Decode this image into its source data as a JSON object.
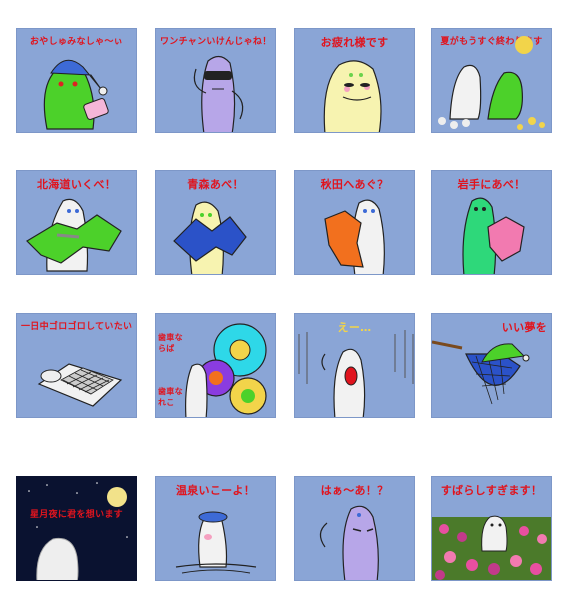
{
  "stickers": [
    {
      "caption": "おやしゅみなしゃ〜ぃ",
      "icon": "sleepy-green-character"
    },
    {
      "caption": "ワンチャンいけんじゃね！",
      "icon": "sunglasses-purple-character"
    },
    {
      "caption": "お疲れ様です",
      "icon": "tired-cream-character"
    },
    {
      "caption": "夏がもうすぐ終わります",
      "icon": "sad-green-and-white-characters"
    },
    {
      "caption": "北海道いくべ！",
      "icon": "hokkaido-map-character"
    },
    {
      "caption": "青森あべ！",
      "icon": "aomori-map-character"
    },
    {
      "caption": "秋田へあぐ？",
      "icon": "akita-map-character"
    },
    {
      "caption": "岩手にあべ！",
      "icon": "iwate-map-character"
    },
    {
      "caption": "一日中ゴロゴロしていたい",
      "icon": "lying-in-bed-character"
    },
    {
      "caption": "歯車なら歯車なれこ",
      "icon": "gears-character"
    },
    {
      "caption": "えー…",
      "icon": "shocked-rain-character"
    },
    {
      "caption": "いい夢を",
      "icon": "hammock-character"
    },
    {
      "caption": "星月夜に君を想います",
      "icon": "starry-night-character"
    },
    {
      "caption": "温泉いこーよ！",
      "icon": "hot-spring-character"
    },
    {
      "caption": "はぁ〜あ！？",
      "icon": "annoyed-purple-character"
    },
    {
      "caption": "すばらしすぎます！",
      "icon": "flower-field-character"
    }
  ],
  "tile10_sub": {
    "top": "歯車ならば",
    "bottom": "歯車なれこ"
  }
}
